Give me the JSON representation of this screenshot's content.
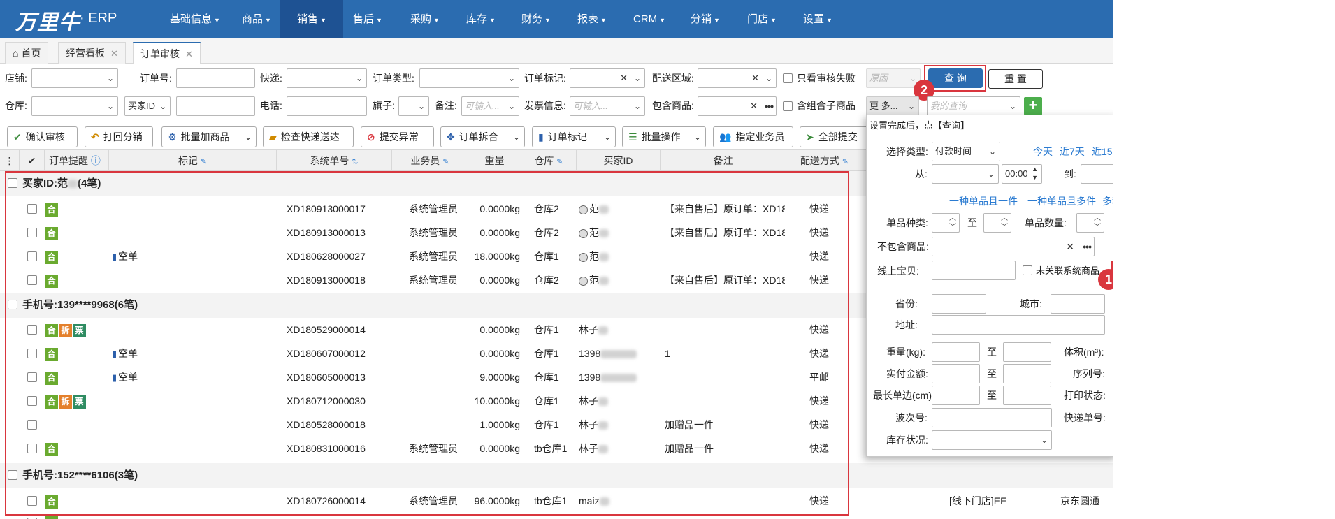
{
  "brand": {
    "logo": "万里牛",
    "sub": "· ERP"
  },
  "nav": [
    "基础信息",
    "商品",
    "销售",
    "售后",
    "采购",
    "库存",
    "财务",
    "报表",
    "CRM",
    "分销",
    "门店",
    "设置"
  ],
  "tabs": [
    {
      "label": "首页"
    },
    {
      "label": "经营看板"
    },
    {
      "label": "订单审核"
    }
  ],
  "filters": {
    "shop_label": "店铺:",
    "order_no_label": "订单号:",
    "express_label": "快递:",
    "order_type_label": "订单类型:",
    "order_mark_label": "订单标记:",
    "region_label": "配送区域:",
    "only_failed_label": "只看审核失败",
    "reason_placeholder": "原因",
    "query_button": "查 询",
    "reset_button": "重 置",
    "warehouse_label": "仓库:",
    "buyer_id_select": "买家ID",
    "phone_label": "电话:",
    "flag_label": "旗子:",
    "remark_label": "备注:",
    "remark_placeholder": "可输入...",
    "invoice_label": "发票信息:",
    "invoice_placeholder": "可输入...",
    "contains_goods_label": "包含商品:",
    "combo_label": "含组合子商品",
    "more_button": "更 多...",
    "my_query_placeholder": "我的查询"
  },
  "toolbar": [
    "确认审核",
    "打回分销",
    "批量加商品",
    "检查快递送达",
    "提交异常",
    "订单拆合",
    "订单标记",
    "批量操作",
    "指定业务员",
    "全部提交"
  ],
  "columns": [
    "订单提醒",
    "标记",
    "系统单号",
    "业务员",
    "重量",
    "仓库",
    "买家ID",
    "备注",
    "配送方式"
  ],
  "groups": [
    {
      "title": "买家ID:范",
      "count": "(4笔)",
      "rows": [
        {
          "tags": [
            "合"
          ],
          "mark": "",
          "order_no": "XD180913000017",
          "staff": "系统管理员",
          "weight": "0.0000kg",
          "warehouse": "仓库2",
          "buyer": "范",
          "note": "【来自售后】原订单：XD18",
          "ship": "快递"
        },
        {
          "tags": [
            "合"
          ],
          "mark": "",
          "order_no": "XD180913000013",
          "staff": "系统管理员",
          "weight": "0.0000kg",
          "warehouse": "仓库2",
          "buyer": "范",
          "note": "【来自售后】原订单：XD18",
          "ship": "快递"
        },
        {
          "tags": [
            "合"
          ],
          "mark": "空单",
          "order_no": "XD180628000027",
          "staff": "系统管理员",
          "weight": "18.0000kg",
          "warehouse": "仓库1",
          "buyer": "范",
          "note": "",
          "ship": "快递"
        },
        {
          "tags": [
            "合"
          ],
          "mark": "",
          "order_no": "XD180913000018",
          "staff": "系统管理员",
          "weight": "0.0000kg",
          "warehouse": "仓库2",
          "buyer": "范",
          "note": "【来自售后】原订单：XD18",
          "ship": "快递"
        }
      ]
    },
    {
      "title": "手机号:139****9968",
      "count": "(6笔)",
      "rows": [
        {
          "tags": [
            "合",
            "拆",
            "票"
          ],
          "mark": "",
          "order_no": "XD180529000014",
          "staff": "",
          "weight": "0.0000kg",
          "warehouse": "仓库1",
          "buyer": "林子",
          "note": "",
          "ship": "快递"
        },
        {
          "tags": [
            "合"
          ],
          "mark": "空单",
          "order_no": "XD180607000012",
          "staff": "",
          "weight": "0.0000kg",
          "warehouse": "仓库1",
          "buyer": "1398",
          "note": "1",
          "ship": "快递"
        },
        {
          "tags": [
            "合"
          ],
          "mark": "空单",
          "order_no": "XD180605000013",
          "staff": "",
          "weight": "9.0000kg",
          "warehouse": "仓库1",
          "buyer": "1398",
          "note": "",
          "ship": "平邮"
        },
        {
          "tags": [
            "合",
            "拆",
            "票"
          ],
          "mark": "",
          "order_no": "XD180712000030",
          "staff": "",
          "weight": "10.0000kg",
          "warehouse": "仓库1",
          "buyer": "林子",
          "note": "",
          "ship": "快递"
        },
        {
          "tags": [],
          "mark": "",
          "order_no": "XD180528000018",
          "staff": "",
          "weight": "1.0000kg",
          "warehouse": "仓库1",
          "buyer": "林子",
          "note": "加赠品一件",
          "ship": "快递"
        },
        {
          "tags": [
            "合"
          ],
          "mark": "",
          "order_no": "XD180831000016",
          "staff": "系统管理员",
          "weight": "0.0000kg",
          "warehouse": "tb仓库1",
          "buyer": "林子",
          "note": "加赠品一件",
          "ship": "快递"
        }
      ]
    },
    {
      "title": "手机号:152****6106",
      "count": "(3笔)",
      "rows": [
        {
          "tags": [
            "合"
          ],
          "mark": "",
          "order_no": "XD180726000014",
          "staff": "系统管理员",
          "weight": "96.0000kg",
          "warehouse": "tb仓库1",
          "buyer": "maiz",
          "note": "",
          "ship": "快递",
          "extra1": "[线下门店]EE",
          "extra2": "京东圆通"
        }
      ]
    }
  ],
  "popup": {
    "hint": "设置完成后，点【查询】",
    "type_label": "选择类型:",
    "type_value": "付款时间",
    "today": "今天",
    "last7": "近7天",
    "last15": "近15",
    "from_label": "从:",
    "time_value": "00:00",
    "to_label": "到:",
    "link_single": "一种单品且一件",
    "link_multi": "一种单品且多件",
    "link_more": "多种",
    "sku_kinds_label": "单品种类:",
    "to_word": "至",
    "sku_qty_label": "单品数量:",
    "exclude_label": "不包含商品:",
    "online_label": "线上宝贝:",
    "unlinked_label": "未关联系统商品",
    "province_label": "省份:",
    "city_label": "城市:",
    "address_label": "地址:",
    "weight_label": "重量(kg):",
    "volume_label": "体积(m³):",
    "paid_label": "实付金额:",
    "serial_label": "序列号:",
    "edge_label": "最长单边(cm)",
    "print_label": "打印状态:",
    "wave_label": "波次号:",
    "tracking_label": "快递单号:",
    "stock_label": "库存状况:"
  },
  "callouts": {
    "one": "1",
    "two": "2"
  },
  "colors": {
    "nav": "#2b6cb0",
    "accent": "#2b6cb0",
    "highlight": "#d9363e",
    "tag_merge": "#6aaa2f",
    "tag_split": "#e4802b",
    "tag_invoice": "#2f8c62"
  }
}
